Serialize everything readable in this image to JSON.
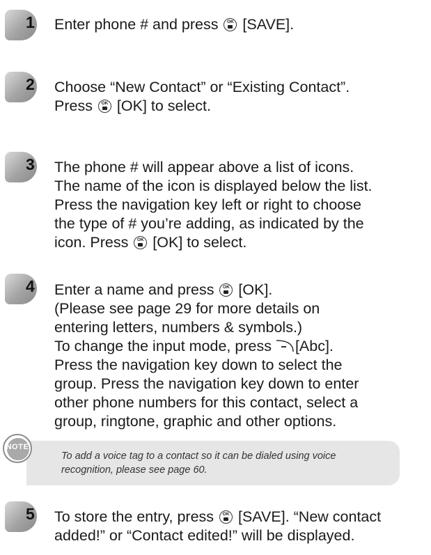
{
  "steps": [
    {
      "number": "1",
      "lines": [
        [
          "Enter phone # and press ",
          {
            "key": "ok"
          },
          " [SAVE]."
        ]
      ]
    },
    {
      "number": "2",
      "lines": [
        [
          "Choose “New Contact” or “Existing Contact”."
        ],
        [
          "Press ",
          {
            "key": "ok"
          },
          " [OK] to select."
        ]
      ]
    },
    {
      "number": "3",
      "lines": [
        [
          "The phone # will appear above a list of icons."
        ],
        [
          "The name of the icon is displayed below the list."
        ],
        [
          "Press the navigation key left or right to choose"
        ],
        [
          "the type of # you’re adding, as indicated by the"
        ],
        [
          "icon.  Press ",
          {
            "key": "ok"
          },
          " [OK] to select."
        ]
      ]
    },
    {
      "number": "4",
      "lines": [
        [
          "Enter a name and press ",
          {
            "key": "ok"
          },
          " [OK]."
        ],
        [
          "(Please see page 29 for more details on"
        ],
        [
          "entering letters, numbers & symbols.)"
        ],
        [
          "To change the input mode, press ",
          {
            "key": "soft"
          },
          "[Abc]."
        ],
        [
          "Press the navigation key down to select the"
        ],
        [
          "group. Press the navigation key down to enter"
        ],
        [
          "other phone numbers for this contact, select a"
        ],
        [
          "group, ringtone, graphic and other options."
        ]
      ]
    },
    {
      "number": "5",
      "lines": [
        [
          "To store the entry, press ",
          {
            "key": "ok"
          },
          " [SAVE]. “New contact"
        ],
        [
          "added!” or “Contact edited!” will be displayed."
        ]
      ]
    }
  ],
  "note": {
    "icon_label": "NOTE",
    "lines": [
      "To add a voice tag to a contact so it can be dialed using voice",
      "recognition, please see page 60."
    ]
  },
  "ok_key": {
    "top": "OK",
    "icon": "camera-icon"
  },
  "colors": {
    "badge": "#a3a3a3",
    "note_bg": "#e6e6e6",
    "text": "#1a1a1a"
  }
}
